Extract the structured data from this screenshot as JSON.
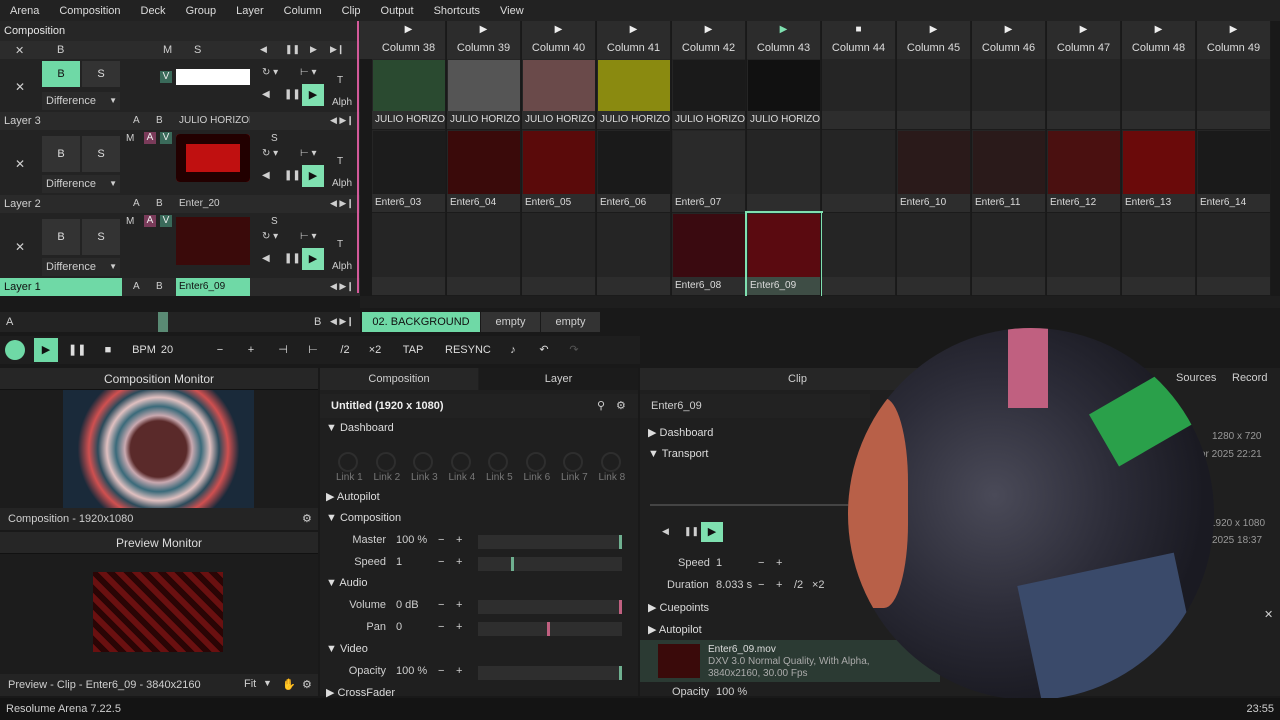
{
  "menu": [
    "Arena",
    "Composition",
    "Deck",
    "Group",
    "Layer",
    "Column",
    "Clip",
    "Output",
    "Shortcuts",
    "View"
  ],
  "composition_label": "Composition",
  "master": {
    "b": "B",
    "s": "S",
    "m": "M",
    "x": "✕"
  },
  "columns": [
    "Column 38",
    "Column 39",
    "Column 40",
    "Column 41",
    "Column 42",
    "Column 43",
    "Column 44",
    "Column 45",
    "Column 46",
    "Column 47",
    "Column 48",
    "Column 49"
  ],
  "layers": [
    {
      "name": "Layer 3",
      "blend": "Difference",
      "clip": "JULIO HORIZONTA...",
      "cells": [
        "JULIO HORIZONT...",
        "JULIO HORIZONT...",
        "JULIO HORIZONT...",
        "JULIO HORIZONT...",
        "JULIO HORIZONT...",
        "JULIO HORIZONT...",
        "",
        "",
        "",
        "",
        "",
        ""
      ]
    },
    {
      "name": "Layer 2",
      "blend": "Difference",
      "clip": "Enter_20",
      "cells": [
        "Enter6_03",
        "Enter6_04",
        "Enter6_05",
        "Enter6_06",
        "Enter6_07",
        "",
        "",
        "Enter6_10",
        "Enter6_11",
        "Enter6_12",
        "Enter6_13",
        "Enter6_14"
      ]
    },
    {
      "name": "Layer 1",
      "blend": "Difference",
      "clip": "Enter6_09",
      "cells": [
        "",
        "",
        "",
        "",
        "Enter6_08",
        "Enter6_09",
        "",
        "",
        "",
        "",
        "",
        ""
      ]
    }
  ],
  "layer_controls": {
    "b": "B",
    "s": "S",
    "m": "M",
    "a": "A",
    "v": "V",
    "t": "T",
    "alph": "Alph"
  },
  "deck_bar": {
    "a": "A",
    "b": "B",
    "decks": [
      "02. BACKGROUND",
      "empty",
      "empty"
    ]
  },
  "transport": {
    "bpm_label": "BPM",
    "bpm": "20",
    "minus": "−",
    "plus": "+",
    "half": "/2",
    "double": "×2",
    "tap": "TAP",
    "resync": "RESYNC"
  },
  "comp_monitor": {
    "title": "Composition Monitor",
    "caption": "Composition - 1920x1080"
  },
  "preview_monitor": {
    "title": "Preview Monitor",
    "caption": "Preview - Clip - Enter6_09 - 3840x2160",
    "fit": "Fit"
  },
  "composition_panel": {
    "tab": "Composition",
    "tab2": "Layer",
    "title": "Untitled (1920 x 1080)",
    "dashboard": "Dashboard",
    "links": [
      "Link 1",
      "Link 2",
      "Link 3",
      "Link 4",
      "Link 5",
      "Link 6",
      "Link 7",
      "Link 8"
    ],
    "autopilot": "Autopilot",
    "composition": "Composition",
    "master_label": "Master",
    "master_val": "100 %",
    "speed_label": "Speed",
    "speed_val": "1",
    "audio": "Audio",
    "volume_label": "Volume",
    "volume_val": "0 dB",
    "pan_label": "Pan",
    "pan_val": "0",
    "video": "Video",
    "opacity_label": "Opacity",
    "opacity_val": "100 %",
    "crossfader": "CrossFader"
  },
  "clip_panel": {
    "tab": "Clip",
    "name": "Enter6_09",
    "dashboard": "Dashboard",
    "transport": "Transport",
    "speed_label": "Speed",
    "speed_val": "1",
    "duration_label": "Duration",
    "duration_val": "8.033 s",
    "half": "/2",
    "double": "×2",
    "cuepoints": "Cuepoints",
    "autopilot": "Autopilot",
    "file": "Enter6_09.mov",
    "file_info1": "DXV 3.0 Normal Quality, With Alpha,",
    "file_info2": "3840x2160, 30.00 Fps",
    "opacity": "Opacity",
    "opacity_val": "100 %"
  },
  "right_tabs": [
    "Sources",
    "Record"
  ],
  "file_meta": [
    "1280 x 720",
    "or 2025 22:21",
    "1920 x 1080",
    "2025 18:37"
  ],
  "status": {
    "app": "Resolume Arena 7.22.5",
    "time": "23:55"
  }
}
